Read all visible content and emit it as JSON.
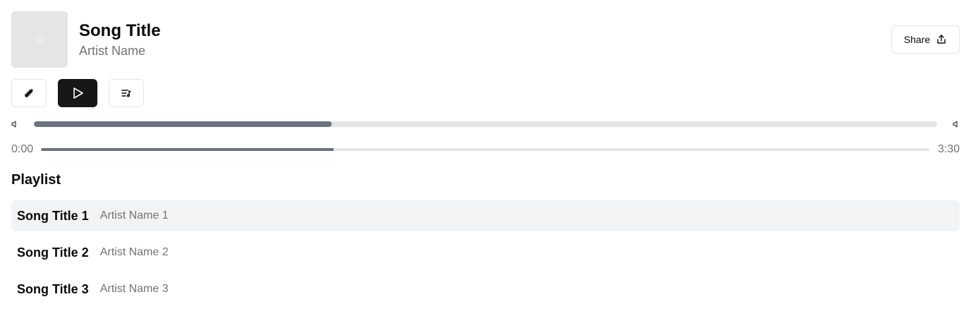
{
  "player": {
    "title": "Song Title",
    "artist": "Artist Name",
    "share_label": "Share",
    "volume": 0.33,
    "progress": 0.33,
    "current_time": "0:00",
    "duration": "3:30"
  },
  "controls": {
    "shuffle_icon": "shuffle-icon",
    "play_icon": "play-icon",
    "playlist_icon": "list-music-icon"
  },
  "playlist": {
    "heading": "Playlist",
    "items": [
      {
        "title": "Song Title 1",
        "artist": "Artist Name 1",
        "active": true
      },
      {
        "title": "Song Title 2",
        "artist": "Artist Name 2",
        "active": false
      },
      {
        "title": "Song Title 3",
        "artist": "Artist Name 3",
        "active": false
      }
    ]
  },
  "colors": {
    "accent": "#171717",
    "track": "#e4e4e7",
    "track_fill": "#6b7280",
    "active_row": "#f2f3f5",
    "muted_text": "#737373"
  }
}
